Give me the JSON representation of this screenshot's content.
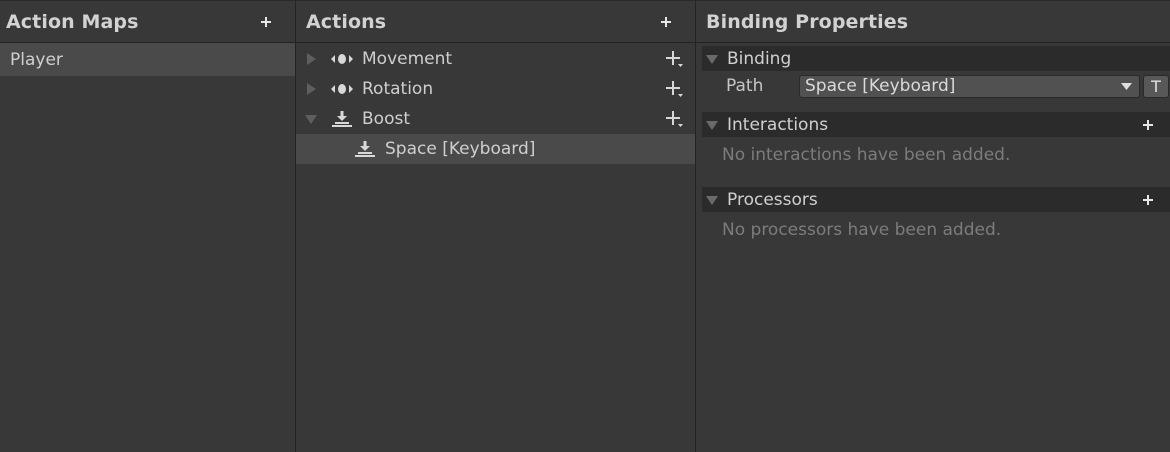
{
  "colors": {
    "background": "#383838",
    "header_border": "#232323",
    "selected_row": "#4a4a4a",
    "section_header": "#2b2b2b",
    "text": "#d0d0d0",
    "muted_text": "#7c7c7c"
  },
  "action_maps": {
    "title": "Action Maps",
    "add_icon": "plus-icon",
    "items": [
      {
        "label": "Player",
        "selected": true
      }
    ]
  },
  "actions": {
    "title": "Actions",
    "add_icon": "plus-icon",
    "tree": [
      {
        "label": "Movement",
        "icon": "value-action-icon",
        "expanded": false
      },
      {
        "label": "Rotation",
        "icon": "value-action-icon",
        "expanded": false
      },
      {
        "label": "Boost",
        "icon": "button-action-icon",
        "expanded": true,
        "bindings": [
          {
            "label": "Space [Keyboard]",
            "icon": "button-action-icon",
            "selected": true
          }
        ]
      }
    ]
  },
  "binding_properties": {
    "title": "Binding Properties",
    "binding_section": {
      "label": "Binding",
      "path_label": "Path",
      "path_value": "Space [Keyboard]",
      "t_button": "T"
    },
    "interactions_section": {
      "label": "Interactions",
      "empty_message": "No interactions have been added."
    },
    "processors_section": {
      "label": "Processors",
      "empty_message": "No processors have been added."
    }
  }
}
